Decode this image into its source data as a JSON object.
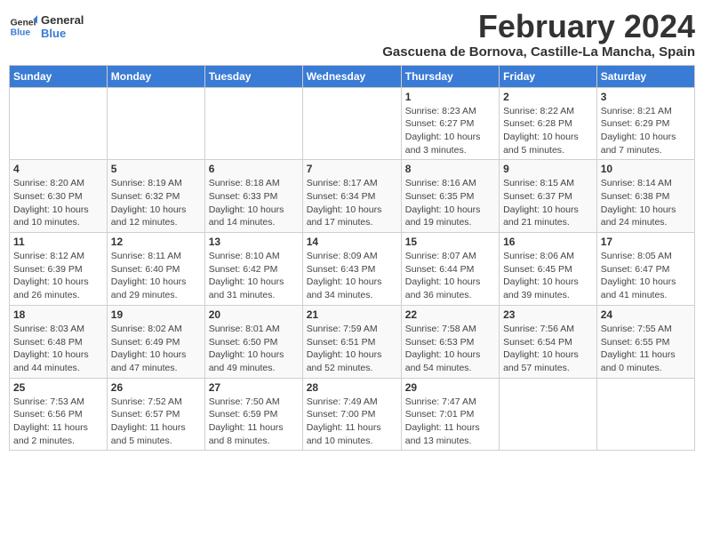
{
  "header": {
    "logo_general": "General",
    "logo_blue": "Blue",
    "month_year": "February 2024",
    "location": "Gascuena de Bornova, Castille-La Mancha, Spain"
  },
  "days_of_week": [
    "Sunday",
    "Monday",
    "Tuesday",
    "Wednesday",
    "Thursday",
    "Friday",
    "Saturday"
  ],
  "weeks": [
    [
      {
        "day": "",
        "info": ""
      },
      {
        "day": "",
        "info": ""
      },
      {
        "day": "",
        "info": ""
      },
      {
        "day": "",
        "info": ""
      },
      {
        "day": "1",
        "info": "Sunrise: 8:23 AM\nSunset: 6:27 PM\nDaylight: 10 hours\nand 3 minutes."
      },
      {
        "day": "2",
        "info": "Sunrise: 8:22 AM\nSunset: 6:28 PM\nDaylight: 10 hours\nand 5 minutes."
      },
      {
        "day": "3",
        "info": "Sunrise: 8:21 AM\nSunset: 6:29 PM\nDaylight: 10 hours\nand 7 minutes."
      }
    ],
    [
      {
        "day": "4",
        "info": "Sunrise: 8:20 AM\nSunset: 6:30 PM\nDaylight: 10 hours\nand 10 minutes."
      },
      {
        "day": "5",
        "info": "Sunrise: 8:19 AM\nSunset: 6:32 PM\nDaylight: 10 hours\nand 12 minutes."
      },
      {
        "day": "6",
        "info": "Sunrise: 8:18 AM\nSunset: 6:33 PM\nDaylight: 10 hours\nand 14 minutes."
      },
      {
        "day": "7",
        "info": "Sunrise: 8:17 AM\nSunset: 6:34 PM\nDaylight: 10 hours\nand 17 minutes."
      },
      {
        "day": "8",
        "info": "Sunrise: 8:16 AM\nSunset: 6:35 PM\nDaylight: 10 hours\nand 19 minutes."
      },
      {
        "day": "9",
        "info": "Sunrise: 8:15 AM\nSunset: 6:37 PM\nDaylight: 10 hours\nand 21 minutes."
      },
      {
        "day": "10",
        "info": "Sunrise: 8:14 AM\nSunset: 6:38 PM\nDaylight: 10 hours\nand 24 minutes."
      }
    ],
    [
      {
        "day": "11",
        "info": "Sunrise: 8:12 AM\nSunset: 6:39 PM\nDaylight: 10 hours\nand 26 minutes."
      },
      {
        "day": "12",
        "info": "Sunrise: 8:11 AM\nSunset: 6:40 PM\nDaylight: 10 hours\nand 29 minutes."
      },
      {
        "day": "13",
        "info": "Sunrise: 8:10 AM\nSunset: 6:42 PM\nDaylight: 10 hours\nand 31 minutes."
      },
      {
        "day": "14",
        "info": "Sunrise: 8:09 AM\nSunset: 6:43 PM\nDaylight: 10 hours\nand 34 minutes."
      },
      {
        "day": "15",
        "info": "Sunrise: 8:07 AM\nSunset: 6:44 PM\nDaylight: 10 hours\nand 36 minutes."
      },
      {
        "day": "16",
        "info": "Sunrise: 8:06 AM\nSunset: 6:45 PM\nDaylight: 10 hours\nand 39 minutes."
      },
      {
        "day": "17",
        "info": "Sunrise: 8:05 AM\nSunset: 6:47 PM\nDaylight: 10 hours\nand 41 minutes."
      }
    ],
    [
      {
        "day": "18",
        "info": "Sunrise: 8:03 AM\nSunset: 6:48 PM\nDaylight: 10 hours\nand 44 minutes."
      },
      {
        "day": "19",
        "info": "Sunrise: 8:02 AM\nSunset: 6:49 PM\nDaylight: 10 hours\nand 47 minutes."
      },
      {
        "day": "20",
        "info": "Sunrise: 8:01 AM\nSunset: 6:50 PM\nDaylight: 10 hours\nand 49 minutes."
      },
      {
        "day": "21",
        "info": "Sunrise: 7:59 AM\nSunset: 6:51 PM\nDaylight: 10 hours\nand 52 minutes."
      },
      {
        "day": "22",
        "info": "Sunrise: 7:58 AM\nSunset: 6:53 PM\nDaylight: 10 hours\nand 54 minutes."
      },
      {
        "day": "23",
        "info": "Sunrise: 7:56 AM\nSunset: 6:54 PM\nDaylight: 10 hours\nand 57 minutes."
      },
      {
        "day": "24",
        "info": "Sunrise: 7:55 AM\nSunset: 6:55 PM\nDaylight: 11 hours\nand 0 minutes."
      }
    ],
    [
      {
        "day": "25",
        "info": "Sunrise: 7:53 AM\nSunset: 6:56 PM\nDaylight: 11 hours\nand 2 minutes."
      },
      {
        "day": "26",
        "info": "Sunrise: 7:52 AM\nSunset: 6:57 PM\nDaylight: 11 hours\nand 5 minutes."
      },
      {
        "day": "27",
        "info": "Sunrise: 7:50 AM\nSunset: 6:59 PM\nDaylight: 11 hours\nand 8 minutes."
      },
      {
        "day": "28",
        "info": "Sunrise: 7:49 AM\nSunset: 7:00 PM\nDaylight: 11 hours\nand 10 minutes."
      },
      {
        "day": "29",
        "info": "Sunrise: 7:47 AM\nSunset: 7:01 PM\nDaylight: 11 hours\nand 13 minutes."
      },
      {
        "day": "",
        "info": ""
      },
      {
        "day": "",
        "info": ""
      }
    ]
  ]
}
